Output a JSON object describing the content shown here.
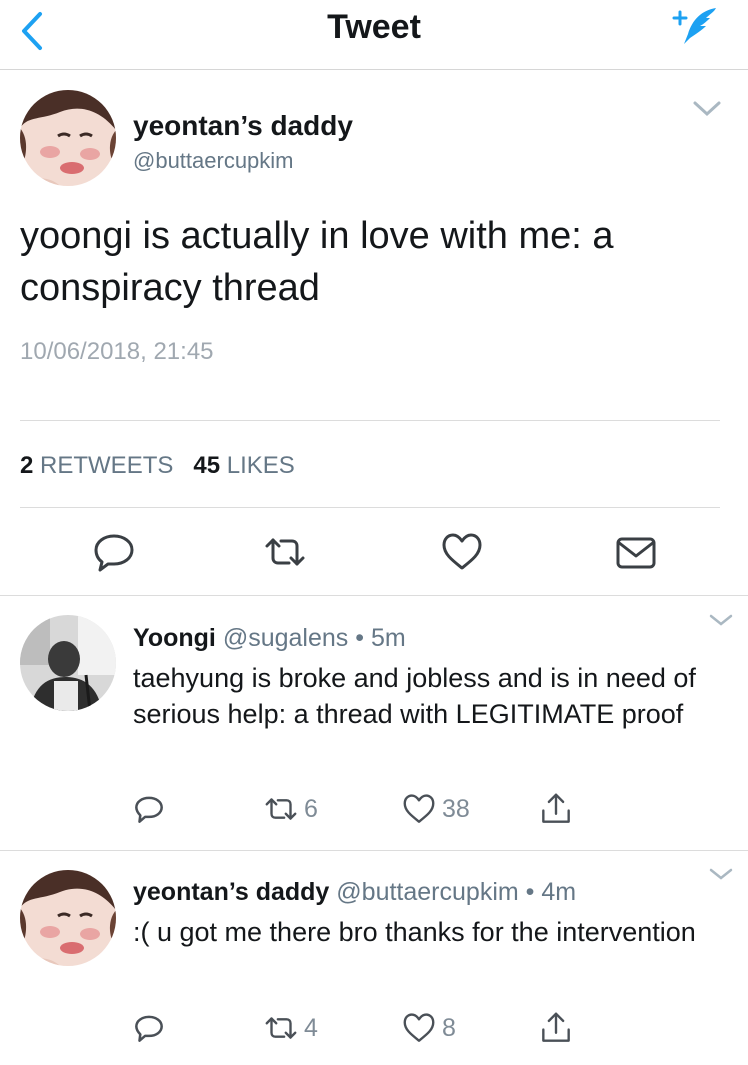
{
  "header": {
    "title": "Tweet"
  },
  "main_tweet": {
    "name": "yeontan’s daddy",
    "handle": "@buttaercupkim",
    "text": "yoongi is actually in love with me: a conspiracy thread",
    "timestamp": "10/06/2018, 21:45",
    "retweet_count": "2",
    "retweet_label": "RETWEETS",
    "like_count": "45",
    "like_label": "LIKES"
  },
  "replies": [
    {
      "name": "Yoongi",
      "handle": "@sugalens",
      "time": "5m",
      "text": "taehyung is broke and jobless and is in need of serious help: a thread with LEGITIMATE proof",
      "retweets": "6",
      "likes": "38"
    },
    {
      "name": "yeontan’s daddy",
      "handle": "@buttaercupkim",
      "time": "4m",
      "text": ":( u got me there bro thanks for the intervention",
      "retweets": "4",
      "likes": "8"
    }
  ],
  "colors": {
    "accent": "#1da1f2",
    "secondary_text": "#657786",
    "icon_gray": "#7f8b96"
  },
  "icons": [
    "back-chevron-icon",
    "compose-tweet-icon",
    "chevron-down-icon",
    "reply-icon",
    "retweet-icon",
    "like-icon",
    "message-icon",
    "share-icon"
  ]
}
